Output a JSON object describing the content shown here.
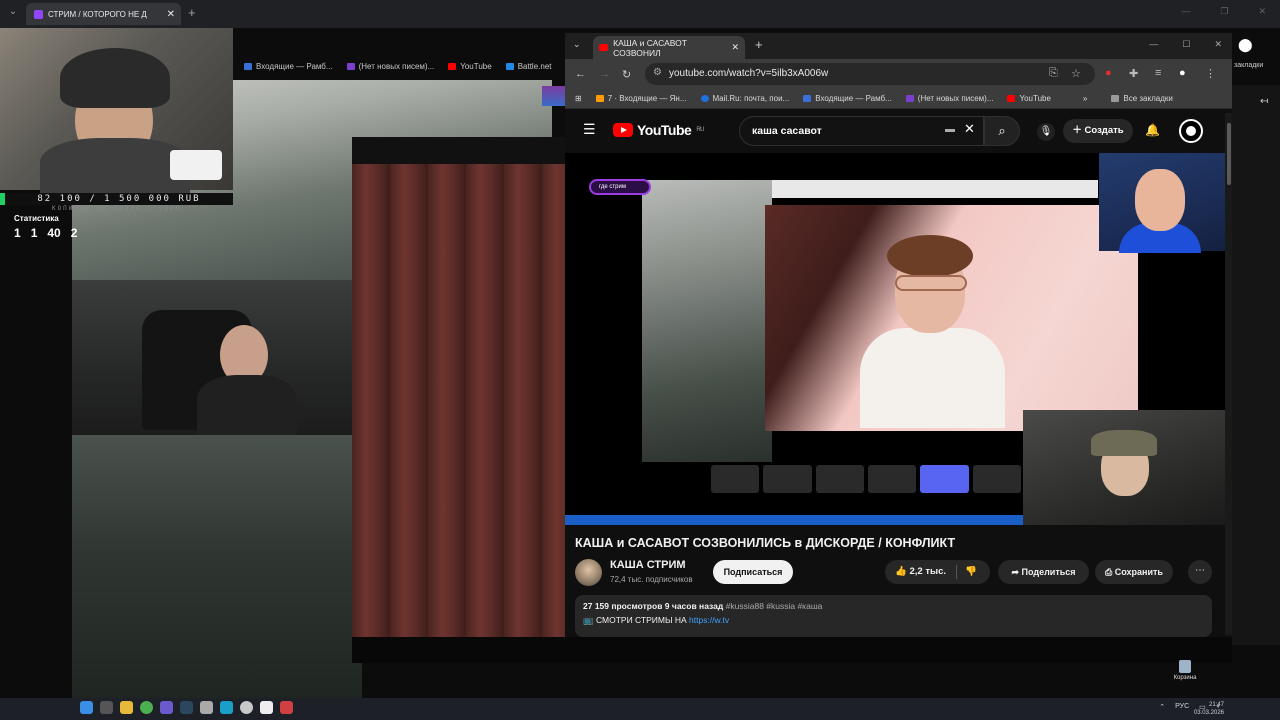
{
  "back_browser": {
    "tab_title": "СТРИМ / КОТОРОГО НЕ Д",
    "bookmarks": [
      "Входящие — Рамб...",
      "(Нет новых писем)...",
      "YouTube",
      "Battle.net"
    ],
    "right_label": "закладки"
  },
  "stream_overlay": {
    "donation_goal": "82 100 / 1 500 000 RUB",
    "donation_subtitle": "КОПИЛКА НА НОВУЮ СТУДИЮ",
    "stats_title": "Статистика",
    "stats": [
      "1",
      "1",
      "40",
      "2"
    ]
  },
  "front_browser": {
    "tab_title": "КАША и САСАВОТ СОЗВОНИЛ",
    "url": "youtube.com/watch?v=5ilb3xA006w",
    "bookmarks": [
      "7 · Входящие — Ян...",
      "Mail.Ru: почта, пои...",
      "Входящие — Рамб...",
      "(Нет новых писем)...",
      "YouTube"
    ],
    "all_bookmarks": "Все закладки"
  },
  "youtube": {
    "logo": "YouTube",
    "logo_region": "RU",
    "search_query": "каша сасавот",
    "create_label": "Создать",
    "video_title": "КАША и САСАВОТ СОЗВОНИЛИСЬ в ДИСКОРДЕ / КОНФЛИКТ",
    "channel_name": "КАША СТРИМ",
    "channel_subs": "72,4 тыс. подписчиков",
    "subscribe_label": "Подписаться",
    "likes": "2,2 тыс.",
    "share_label": "Поделиться",
    "save_label": "Сохранить",
    "views": "27 159 просмотров",
    "time_ago": "9 часов назад",
    "tags": "#kussia88 #kussia #каша",
    "desc_line": "СМОТРИ СТРИМЫ НА",
    "desc_link": "https://w.tv",
    "overlay_pill": "где стрим"
  },
  "taskbar": {
    "tray_lang": "РУС",
    "time": "21:47",
    "date": "03.03.2026",
    "recycle_label": "Корзина"
  }
}
